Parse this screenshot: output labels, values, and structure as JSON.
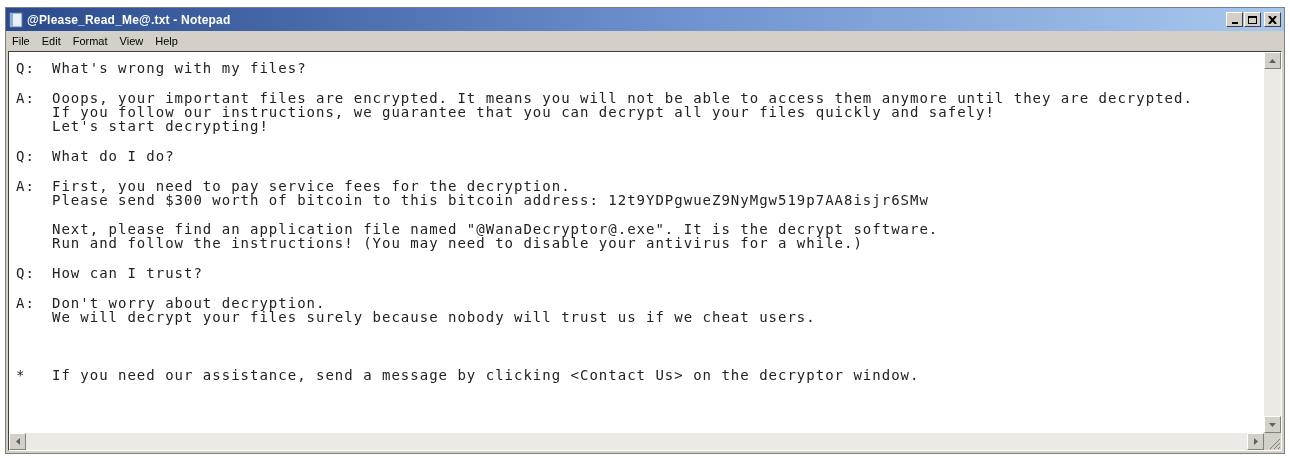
{
  "window": {
    "title": "@Please_Read_Me@.txt - Notepad"
  },
  "menu": [
    "File",
    "Edit",
    "Format",
    "View",
    "Help"
  ],
  "blocks": [
    {
      "kind": "question",
      "label": "Q:",
      "lines": [
        "What's wrong with my files?"
      ]
    },
    {
      "kind": "answer",
      "label": "A:",
      "lines": [
        "Ooops, your important files are encrypted. It means you will not be able to access them anymore until they are decrypted.",
        "If you follow our instructions, we guarantee that you can decrypt all your files quickly and safely!",
        "Let's start decrypting!"
      ]
    },
    {
      "kind": "question",
      "label": "Q:",
      "lines": [
        "What do I do?"
      ]
    },
    {
      "kind": "answer",
      "label": "A:",
      "lines": [
        "First, you need to pay service fees for the decryption.",
        "Please send $300 worth of bitcoin to this bitcoin address: 12t9YDPgwueZ9NyMgw519p7AA8isjr6SMw"
      ]
    },
    {
      "kind": "continuation",
      "lines": [
        "Next, please find an application file named \"@WanaDecryptor@.exe\". It is the decrypt software.",
        "Run and follow the instructions! (You may need to disable your antivirus for a while.)"
      ]
    },
    {
      "kind": "question",
      "label": "Q:",
      "lines": [
        "How can I trust?"
      ]
    },
    {
      "kind": "answer",
      "label": "A:",
      "lines": [
        "Don't worry about decryption.",
        "We will decrypt your files surely because nobody will trust us if we cheat users."
      ]
    },
    {
      "kind": "note",
      "label": "*",
      "lines": [
        "If you need our assistance, send a message by clicking <Contact Us> on the decryptor window."
      ]
    }
  ]
}
